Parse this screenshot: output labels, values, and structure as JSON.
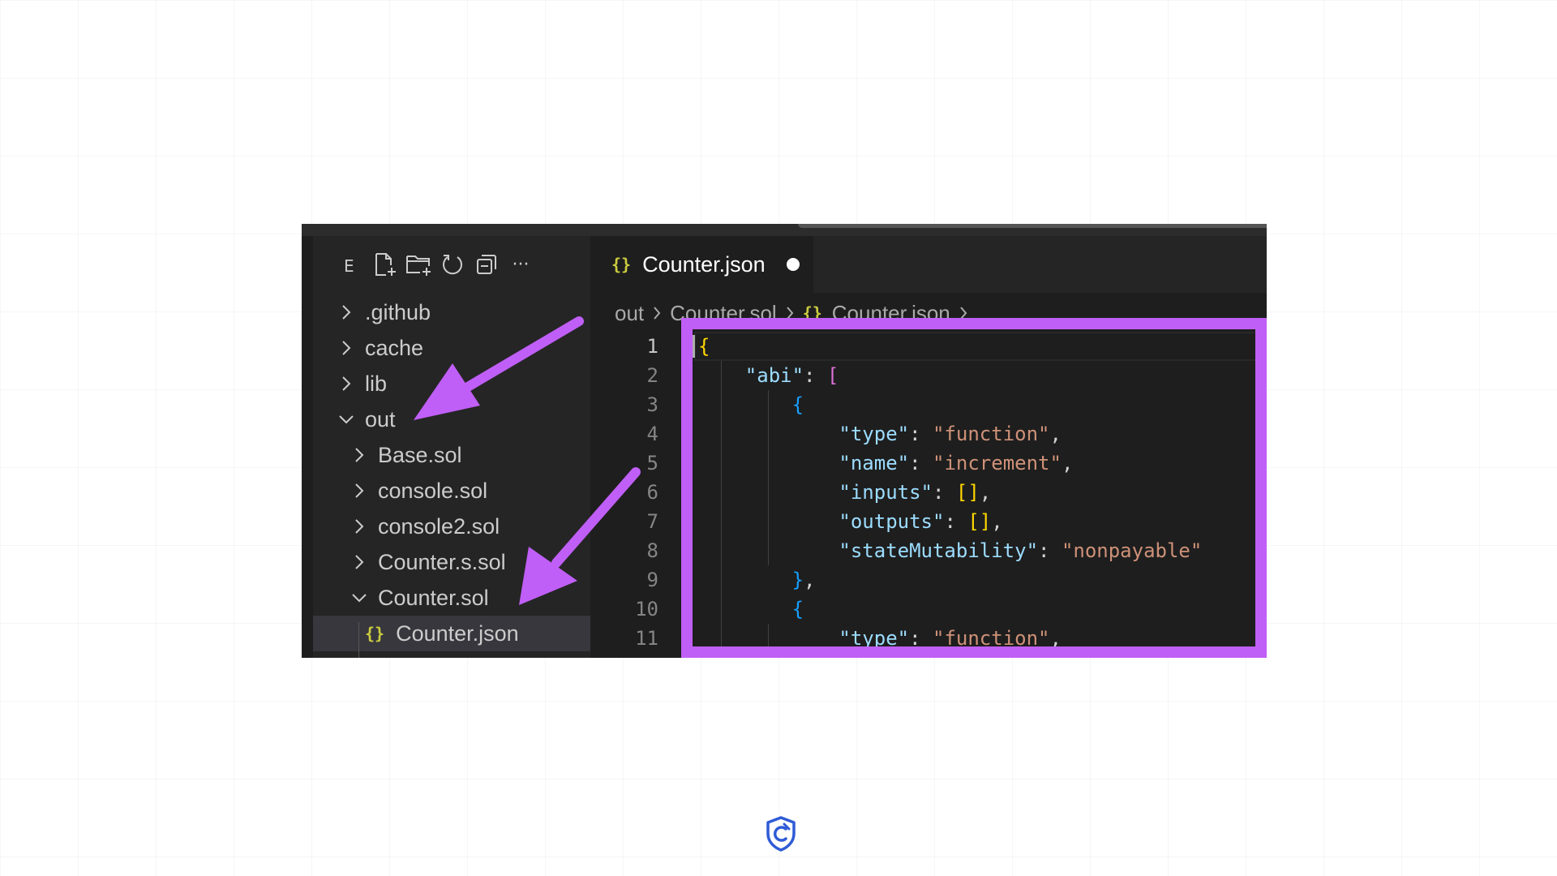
{
  "explorer": {
    "title": "E",
    "toolbar_icons": [
      "new-file-icon",
      "new-folder-icon",
      "refresh-icon",
      "collapse-all-icon",
      "more-icon"
    ],
    "more_label": "···",
    "items": [
      {
        "label": ".github",
        "expanded": false,
        "depth": 0
      },
      {
        "label": "cache",
        "expanded": false,
        "depth": 0
      },
      {
        "label": "lib",
        "expanded": false,
        "depth": 0
      },
      {
        "label": "out",
        "expanded": true,
        "depth": 0
      },
      {
        "label": "Base.sol",
        "expanded": false,
        "depth": 1
      },
      {
        "label": "console.sol",
        "expanded": false,
        "depth": 1
      },
      {
        "label": "console2.sol",
        "expanded": false,
        "depth": 1
      },
      {
        "label": "Counter.s.sol",
        "expanded": false,
        "depth": 1
      },
      {
        "label": "Counter.sol",
        "expanded": true,
        "depth": 1
      },
      {
        "label": "Counter.json",
        "type": "json",
        "selected": true,
        "depth": 2
      }
    ]
  },
  "json_icon_glyph": "{}",
  "editor": {
    "tab": {
      "label": "Counter.json",
      "unsaved": true
    },
    "breadcrumb": [
      "out",
      "Counter.sol",
      "Counter.json"
    ],
    "active_line": 1,
    "lines": [
      {
        "n": "1",
        "tokens": [
          {
            "t": "{",
            "c": "b1"
          }
        ]
      },
      {
        "n": "2",
        "tokens": [
          {
            "t": "    "
          },
          {
            "t": "\"abi\"",
            "c": "k"
          },
          {
            "t": ": ",
            "c": "p"
          },
          {
            "t": "[",
            "c": "b2"
          }
        ]
      },
      {
        "n": "3",
        "tokens": [
          {
            "t": "        "
          },
          {
            "t": "{",
            "c": "b3"
          }
        ]
      },
      {
        "n": "4",
        "tokens": [
          {
            "t": "            "
          },
          {
            "t": "\"type\"",
            "c": "k"
          },
          {
            "t": ": ",
            "c": "p"
          },
          {
            "t": "\"function\"",
            "c": "s"
          },
          {
            "t": ",",
            "c": "p"
          }
        ]
      },
      {
        "n": "5",
        "tokens": [
          {
            "t": "            "
          },
          {
            "t": "\"name\"",
            "c": "k"
          },
          {
            "t": ": ",
            "c": "p"
          },
          {
            "t": "\"increment\"",
            "c": "s"
          },
          {
            "t": ",",
            "c": "p"
          }
        ]
      },
      {
        "n": "6",
        "tokens": [
          {
            "t": "            "
          },
          {
            "t": "\"inputs\"",
            "c": "k"
          },
          {
            "t": ": ",
            "c": "p"
          },
          {
            "t": "[]",
            "c": "b1"
          },
          {
            "t": ",",
            "c": "p"
          }
        ]
      },
      {
        "n": "7",
        "tokens": [
          {
            "t": "            "
          },
          {
            "t": "\"outputs\"",
            "c": "k"
          },
          {
            "t": ": ",
            "c": "p"
          },
          {
            "t": "[]",
            "c": "b1"
          },
          {
            "t": ",",
            "c": "p"
          }
        ]
      },
      {
        "n": "8",
        "tokens": [
          {
            "t": "            "
          },
          {
            "t": "\"stateMutability\"",
            "c": "k"
          },
          {
            "t": ": ",
            "c": "p"
          },
          {
            "t": "\"nonpayable\"",
            "c": "s"
          }
        ]
      },
      {
        "n": "9",
        "tokens": [
          {
            "t": "        "
          },
          {
            "t": "}",
            "c": "b3"
          },
          {
            "t": ",",
            "c": "p"
          }
        ]
      },
      {
        "n": "10",
        "tokens": [
          {
            "t": "        "
          },
          {
            "t": "{",
            "c": "b3"
          }
        ]
      },
      {
        "n": "11",
        "tokens": [
          {
            "t": "            "
          },
          {
            "t": "\"type\"",
            "c": "k"
          },
          {
            "t": ": ",
            "c": "p"
          },
          {
            "t": "\"function\"",
            "c": "s"
          },
          {
            "t": ",",
            "c": "p"
          }
        ]
      }
    ]
  },
  "annotations": {
    "color": "#c05ff7"
  },
  "colors": {
    "editor_bg": "#1e1e1e",
    "sidebar_bg": "#252526",
    "json_icon": "#cbcb41",
    "accent": "#c05ff7",
    "logo": "#2f5bd6"
  }
}
